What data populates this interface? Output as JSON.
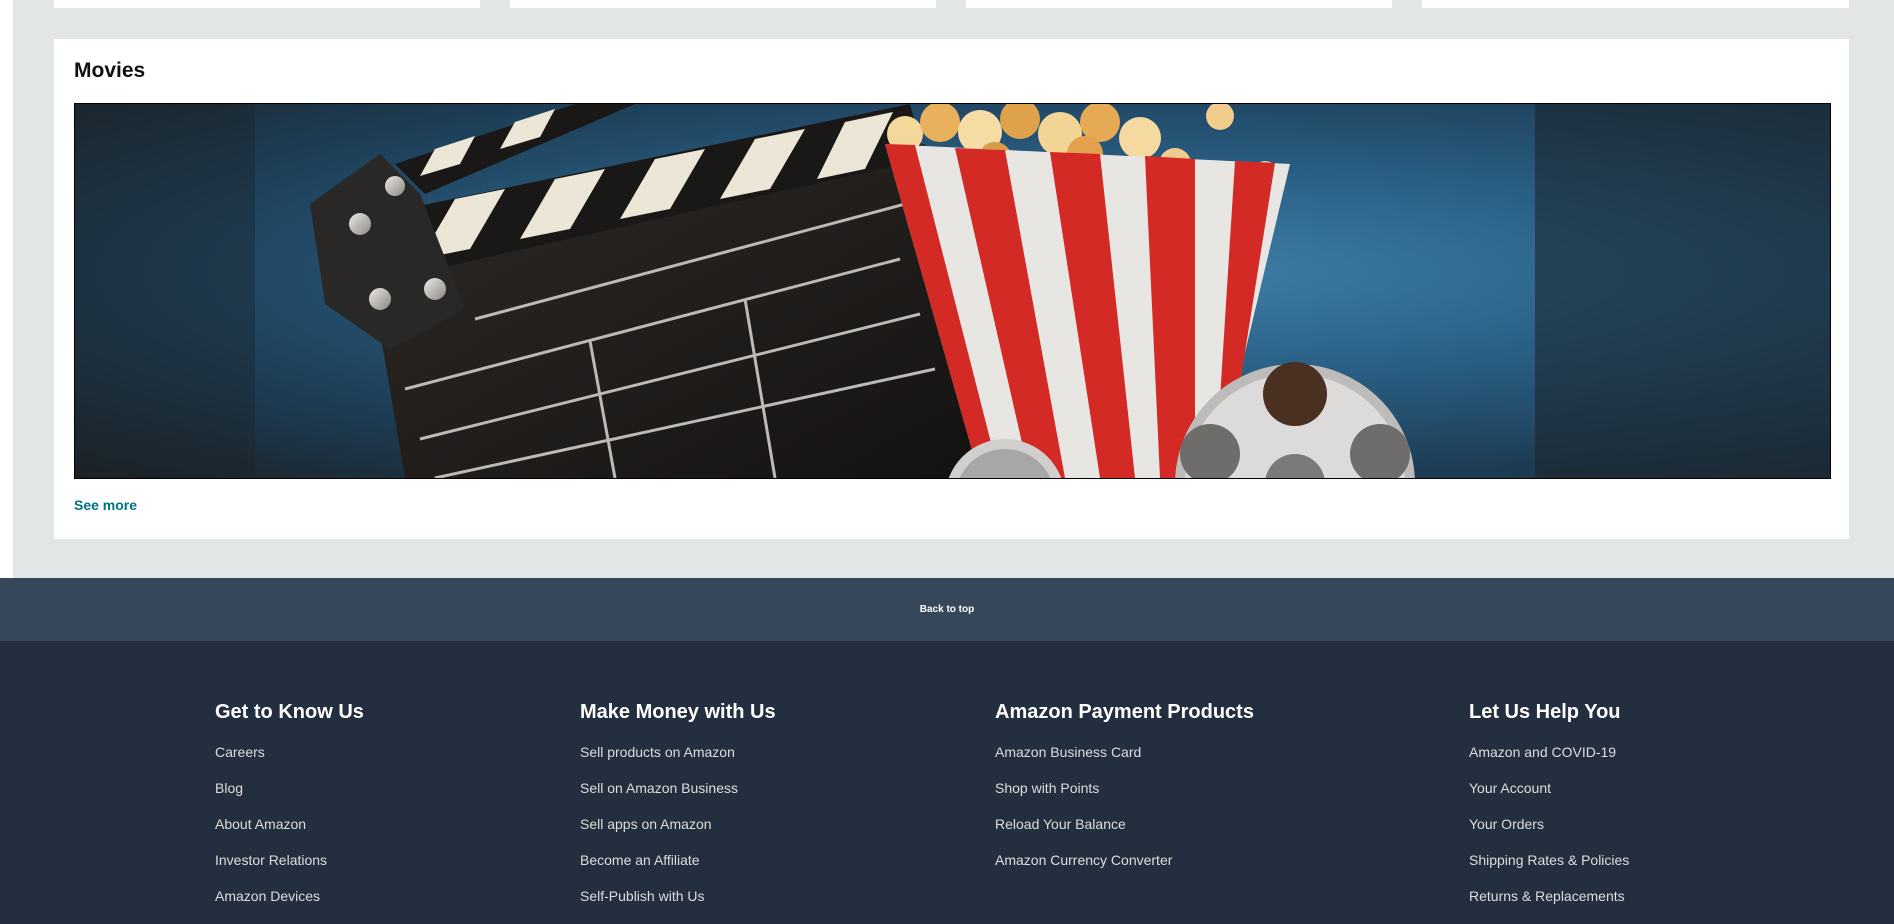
{
  "movies": {
    "title": "Movies",
    "image_alt": "Movie clapperboard, popcorn bucket and film reel",
    "see_more_label": "See more"
  },
  "back_to_top_label": "Back to top",
  "footer": {
    "columns": [
      {
        "heading": "Get to Know Us",
        "links": [
          "Careers",
          "Blog",
          "About Amazon",
          "Investor Relations",
          "Amazon Devices"
        ]
      },
      {
        "heading": "Make Money with Us",
        "links": [
          "Sell products on Amazon",
          "Sell on Amazon Business",
          "Sell apps on Amazon",
          "Become an Affiliate",
          "Self-Publish with Us"
        ]
      },
      {
        "heading": "Amazon Payment Products",
        "links": [
          "Amazon Business Card",
          "Shop with Points",
          "Reload Your Balance",
          "Amazon Currency Converter"
        ]
      },
      {
        "heading": "Let Us Help You",
        "links": [
          "Amazon and COVID-19",
          "Your Account",
          "Your Orders",
          "Shipping Rates & Policies",
          "Returns & Replacements"
        ]
      }
    ]
  },
  "colors": {
    "page_bg": "#E3E6E6",
    "card_bg": "#FFFFFF",
    "link_teal": "#007185",
    "back_to_top_bg": "#37475A",
    "footer_bg": "#232F3E",
    "footer_link": "#DDDDDD"
  }
}
